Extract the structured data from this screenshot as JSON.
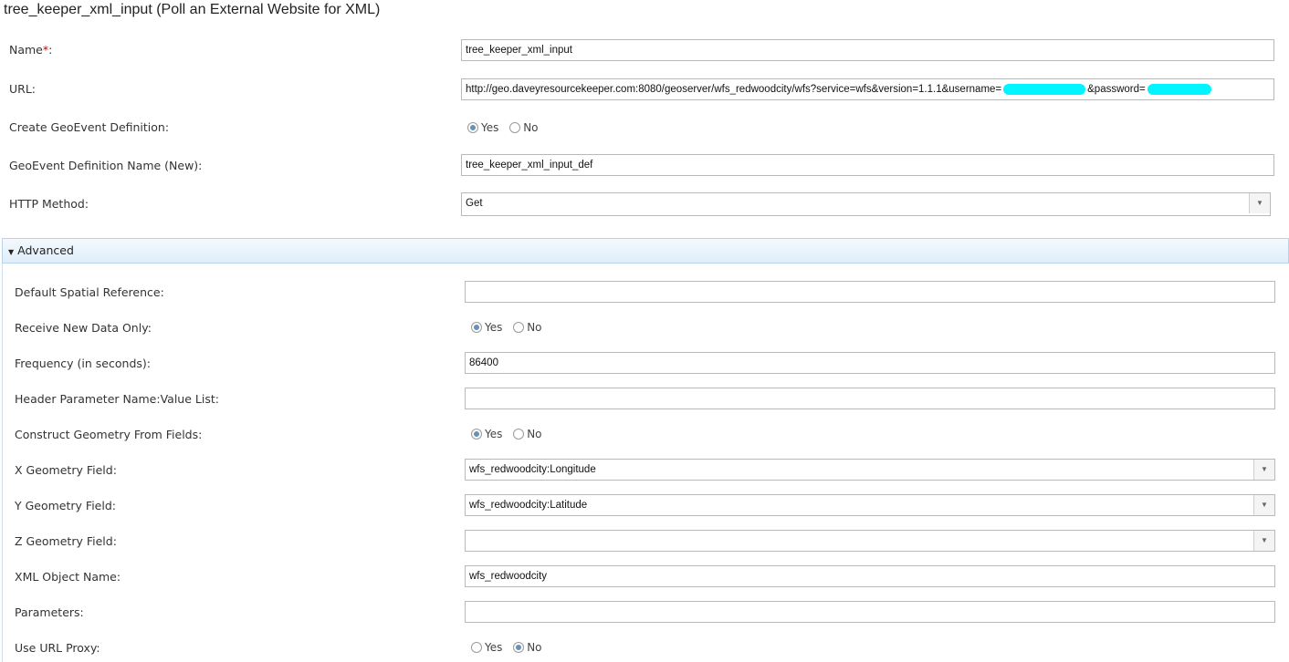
{
  "title": "tree_keeper_xml_input (Poll an External Website for XML)",
  "fields": {
    "name": {
      "label": "Name",
      "required_mark": "*",
      "suffix": ":",
      "value": "tree_keeper_xml_input"
    },
    "url": {
      "label": "URL:",
      "value_part1": "http://geo.daveyresourcekeeper.com:8080/geoserver/wfs_redwoodcity/wfs?service=wfs&version=1.1.1&username=",
      "value_part2": "&password="
    },
    "create_def": {
      "label": "Create GeoEvent Definition:",
      "options": [
        "Yes",
        "No"
      ],
      "selected": "Yes"
    },
    "def_name": {
      "label": "GeoEvent Definition Name (New):",
      "value": "tree_keeper_xml_input_def"
    },
    "http_method": {
      "label": "HTTP Method:",
      "value": "Get"
    }
  },
  "advanced": {
    "header": "Advanced",
    "spatial_ref": {
      "label": "Default Spatial Reference:",
      "value": ""
    },
    "new_data_only": {
      "label": "Receive New Data Only:",
      "options": [
        "Yes",
        "No"
      ],
      "selected": "Yes"
    },
    "frequency": {
      "label": "Frequency (in seconds):",
      "value": "86400"
    },
    "header_params": {
      "label": "Header Parameter Name:Value List:",
      "value": ""
    },
    "construct_geom": {
      "label": "Construct Geometry From Fields:",
      "options": [
        "Yes",
        "No"
      ],
      "selected": "Yes"
    },
    "x_field": {
      "label": "X Geometry Field:",
      "value": "wfs_redwoodcity:Longitude"
    },
    "y_field": {
      "label": "Y Geometry Field:",
      "value": "wfs_redwoodcity:Latitude"
    },
    "z_field": {
      "label": "Z Geometry Field:",
      "value": ""
    },
    "xml_object": {
      "label": "XML Object Name:",
      "value": "wfs_redwoodcity"
    },
    "parameters": {
      "label": "Parameters:",
      "value": ""
    },
    "url_proxy": {
      "label": "Use URL Proxy:",
      "options": [
        "Yes",
        "No"
      ],
      "selected": "No"
    }
  },
  "icons": {
    "dropdown": "chevron-down-icon",
    "collapse": "caret-down-icon"
  },
  "colors": {
    "redaction": "#00f5ff",
    "header_bg": "#dfeefa",
    "required": "#cc0000"
  }
}
